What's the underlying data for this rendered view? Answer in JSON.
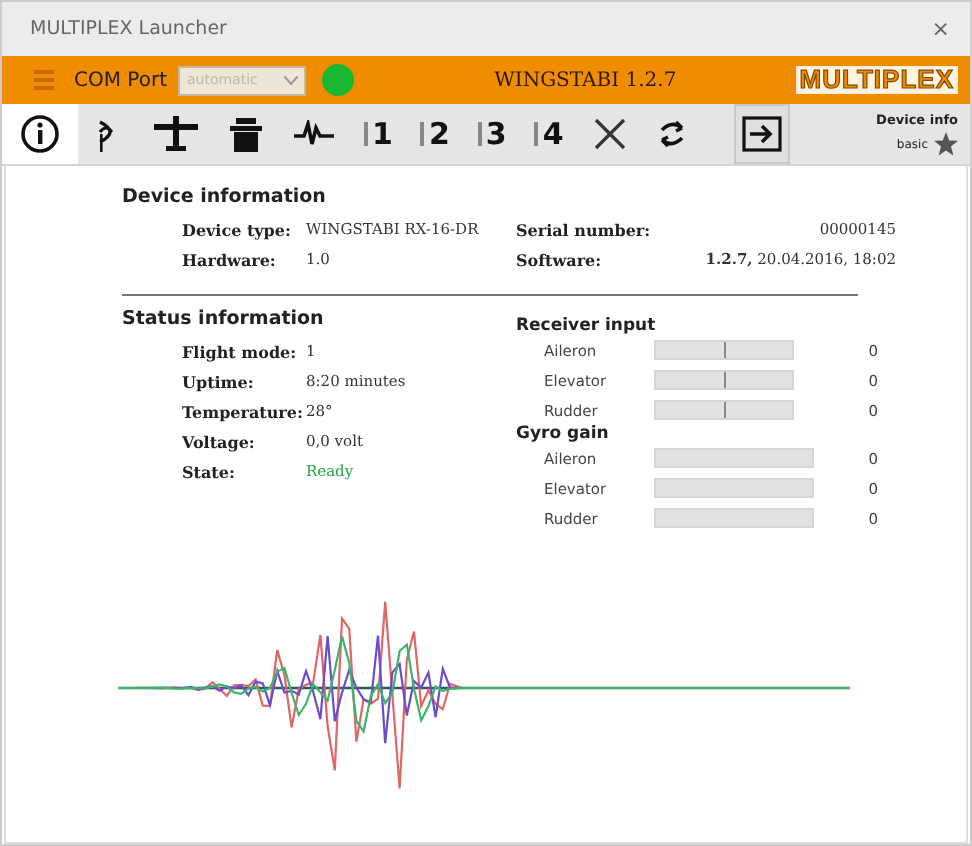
{
  "window": {
    "title": "MULTIPLEX Launcher",
    "close": "×"
  },
  "header": {
    "com_port_label": "COM Port",
    "com_port": {
      "value": "automatic",
      "disabled": true
    },
    "connection": {
      "color": "#19b832"
    },
    "title": "WINGSTABI 1.2.7",
    "logo": "MULTIPLEX"
  },
  "tabs": [
    {
      "kind": "info",
      "selected": true
    },
    {
      "kind": "signal",
      "selected": false
    },
    {
      "kind": "plane",
      "selected": false
    },
    {
      "kind": "block",
      "selected": false
    },
    {
      "kind": "wave",
      "selected": false
    },
    {
      "kind": "number",
      "label": "1",
      "selected": false
    },
    {
      "kind": "number",
      "label": "2",
      "selected": false
    },
    {
      "kind": "number",
      "label": "3",
      "selected": false
    },
    {
      "kind": "number",
      "label": "4",
      "selected": false
    },
    {
      "kind": "tools",
      "selected": false
    },
    {
      "kind": "sync",
      "selected": false
    }
  ],
  "device_info_badge": {
    "title": "Device info",
    "level_label": "basic"
  },
  "device_information": {
    "heading": "Device information",
    "left": [
      {
        "label": "Device type:",
        "value": "WINGSTABI RX-16-DR"
      },
      {
        "label": "Hardware:",
        "value": "1.0"
      }
    ],
    "right": [
      {
        "label": "Serial number:",
        "value": "00000145"
      },
      {
        "label": "Software:",
        "value": "**1.2.7,** 20.04.2016, 18:02"
      }
    ]
  },
  "status_information": {
    "heading": "Status information",
    "rows": [
      {
        "label": "Flight mode:",
        "value": "1",
        "kind": "plain"
      },
      {
        "label": "Uptime:",
        "value": "8:20 minutes",
        "kind": "plain"
      },
      {
        "label": "Temperature:",
        "value": "28°",
        "kind": "plain"
      },
      {
        "label": "Voltage:",
        "value": "0,0 volt",
        "kind": "plain"
      },
      {
        "label": "State:",
        "value": "Ready",
        "kind": "ok"
      }
    ]
  },
  "receiver_input": {
    "heading": "Receiver input",
    "channels": [
      {
        "name": "Aileron",
        "level": 0.5,
        "reading": "0"
      },
      {
        "name": "Elevator",
        "level": 0.5,
        "reading": "0"
      },
      {
        "name": "Rudder",
        "level": 0.5,
        "reading": "0"
      }
    ]
  },
  "gyro_gain": {
    "heading": "Gyro gain",
    "channels": [
      {
        "name": "Aileron",
        "level": 0,
        "reading": "0"
      },
      {
        "name": "Elevator",
        "level": 0,
        "reading": "0"
      },
      {
        "name": "Rudder",
        "level": 0,
        "reading": "0"
      }
    ]
  }
}
